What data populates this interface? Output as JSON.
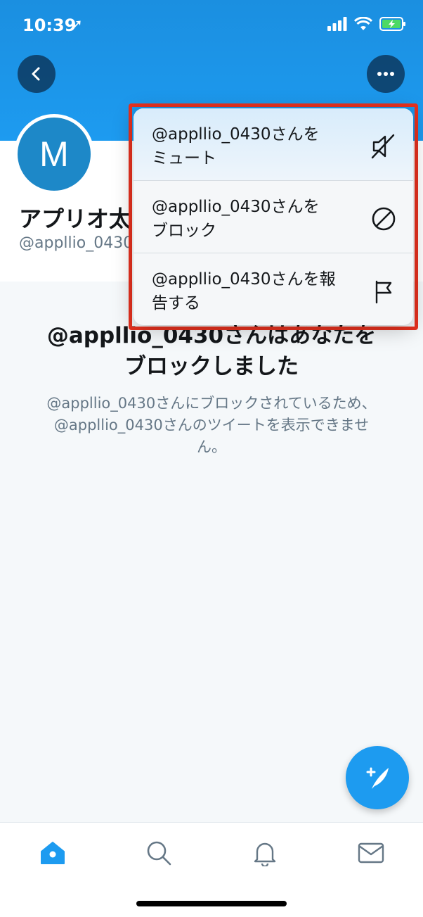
{
  "status_bar": {
    "time": "10:39",
    "location_glyph": "➚",
    "icons": [
      "signal-icon",
      "wifi-icon",
      "battery-charging-icon"
    ]
  },
  "header": {
    "back_icon": "chevron-left-icon",
    "more_icon": "more-icon"
  },
  "profile": {
    "avatar_letter": "M",
    "display_name": "アプリオ太",
    "handle": "@appllio_0430"
  },
  "blocked_notice": {
    "title_line1": "@appllio_0430さんはあなたを",
    "title_line2": "ブロックしました",
    "description": "@appllio_0430さんにブロックされているため、@appllio_0430さんのツイートを表示できません。"
  },
  "dropdown_menu": {
    "items": [
      {
        "label_line1": "@appllio_0430さんを",
        "label_line2": "ミュート",
        "icon": "mute-icon"
      },
      {
        "label_line1": "@appllio_0430さんを",
        "label_line2": "ブロック",
        "icon": "block-icon"
      },
      {
        "label_line1": "@appllio_0430さんを報",
        "label_line2": "告する",
        "icon": "flag-icon"
      }
    ]
  },
  "fab": {
    "icon": "compose-tweet-icon"
  },
  "tab_bar": {
    "tabs": [
      "home-icon",
      "search-icon",
      "notifications-icon",
      "messages-icon"
    ],
    "active": "home-icon"
  },
  "colors": {
    "brand_blue": "#1d9bf0",
    "highlight_red": "#e8311f",
    "muted_text": "#657786"
  }
}
